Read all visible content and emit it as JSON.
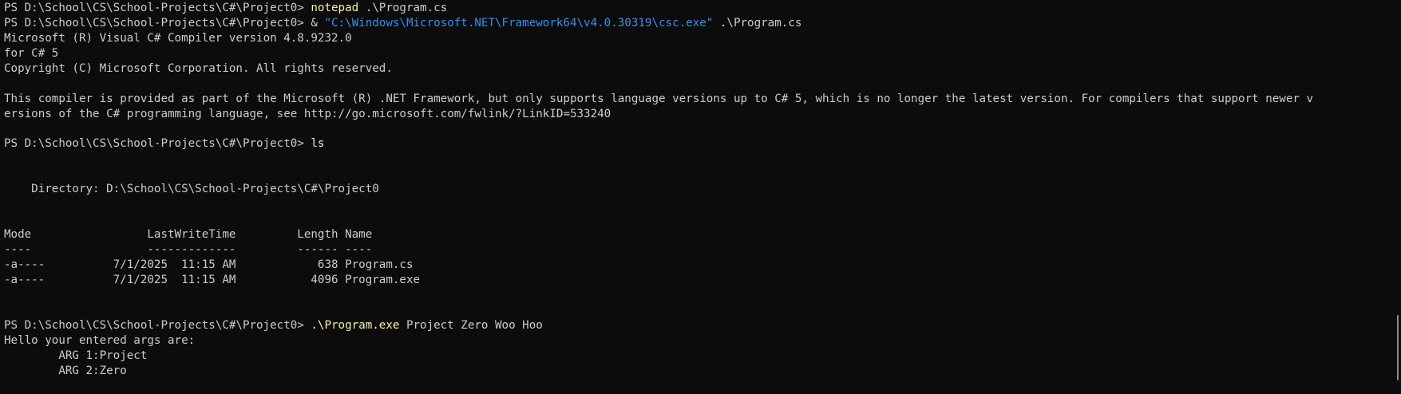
{
  "terminal": {
    "colors": {
      "background": "#0c0c0c",
      "text": "#cccccc",
      "command": "#f9f1a5",
      "string": "#3b8eea"
    },
    "prompt": "PS D:\\School\\CS\\School-Projects\\C#\\Project0> ",
    "line1": {
      "command": "notepad",
      "args": " .\\Program.cs"
    },
    "line2": {
      "operator": "& ",
      "path": "\"C:\\Windows\\Microsoft.NET\\Framework64\\v4.0.30319\\csc.exe\"",
      "args": " .\\Program.cs"
    },
    "compiler_output": [
      "Microsoft (R) Visual C# Compiler version 4.8.9232.0",
      "for C# 5",
      "Copyright (C) Microsoft Corporation. All rights reserved.",
      "",
      "This compiler is provided as part of the Microsoft (R) .NET Framework, but only supports language versions up to C# 5, which is no longer the latest version. For compilers that support newer v",
      "ersions of the C# programming language, see http://go.microsoft.com/fwlink/?LinkID=533240",
      ""
    ],
    "line_ls": {
      "command": "ls"
    },
    "listing": {
      "directory_line": "    Directory: D:\\School\\CS\\School-Projects\\C#\\Project0",
      "header": "Mode                 LastWriteTime         Length Name",
      "separator": "----                 -------------         ------ ----",
      "rows": [
        "-a----          7/1/2025  11:15 AM            638 Program.cs",
        "-a----          7/1/2025  11:15 AM           4096 Program.exe"
      ]
    },
    "line_run": {
      "command": ".\\Program.exe",
      "args": " Project Zero Woo Hoo"
    },
    "program_output": [
      "Hello your entered args are:",
      "        ARG 1:Project",
      "        ARG 2:Zero"
    ]
  }
}
